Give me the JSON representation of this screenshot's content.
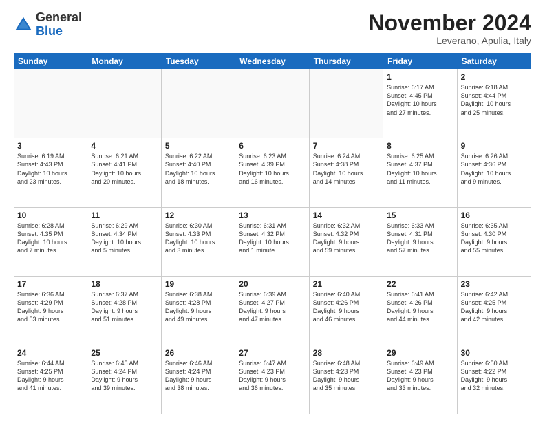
{
  "logo": {
    "line1": "General",
    "line2": "Blue",
    "icon_color": "#1a6bbf"
  },
  "title": "November 2024",
  "location": "Leverano, Apulia, Italy",
  "days_of_week": [
    "Sunday",
    "Monday",
    "Tuesday",
    "Wednesday",
    "Thursday",
    "Friday",
    "Saturday"
  ],
  "weeks": [
    [
      {
        "day": "",
        "info": "",
        "empty": true
      },
      {
        "day": "",
        "info": "",
        "empty": true
      },
      {
        "day": "",
        "info": "",
        "empty": true
      },
      {
        "day": "",
        "info": "",
        "empty": true
      },
      {
        "day": "",
        "info": "",
        "empty": true
      },
      {
        "day": "1",
        "info": "Sunrise: 6:17 AM\nSunset: 4:45 PM\nDaylight: 10 hours\nand 27 minutes."
      },
      {
        "day": "2",
        "info": "Sunrise: 6:18 AM\nSunset: 4:44 PM\nDaylight: 10 hours\nand 25 minutes."
      }
    ],
    [
      {
        "day": "3",
        "info": "Sunrise: 6:19 AM\nSunset: 4:43 PM\nDaylight: 10 hours\nand 23 minutes."
      },
      {
        "day": "4",
        "info": "Sunrise: 6:21 AM\nSunset: 4:41 PM\nDaylight: 10 hours\nand 20 minutes."
      },
      {
        "day": "5",
        "info": "Sunrise: 6:22 AM\nSunset: 4:40 PM\nDaylight: 10 hours\nand 18 minutes."
      },
      {
        "day": "6",
        "info": "Sunrise: 6:23 AM\nSunset: 4:39 PM\nDaylight: 10 hours\nand 16 minutes."
      },
      {
        "day": "7",
        "info": "Sunrise: 6:24 AM\nSunset: 4:38 PM\nDaylight: 10 hours\nand 14 minutes."
      },
      {
        "day": "8",
        "info": "Sunrise: 6:25 AM\nSunset: 4:37 PM\nDaylight: 10 hours\nand 11 minutes."
      },
      {
        "day": "9",
        "info": "Sunrise: 6:26 AM\nSunset: 4:36 PM\nDaylight: 10 hours\nand 9 minutes."
      }
    ],
    [
      {
        "day": "10",
        "info": "Sunrise: 6:28 AM\nSunset: 4:35 PM\nDaylight: 10 hours\nand 7 minutes."
      },
      {
        "day": "11",
        "info": "Sunrise: 6:29 AM\nSunset: 4:34 PM\nDaylight: 10 hours\nand 5 minutes."
      },
      {
        "day": "12",
        "info": "Sunrise: 6:30 AM\nSunset: 4:33 PM\nDaylight: 10 hours\nand 3 minutes."
      },
      {
        "day": "13",
        "info": "Sunrise: 6:31 AM\nSunset: 4:32 PM\nDaylight: 10 hours\nand 1 minute."
      },
      {
        "day": "14",
        "info": "Sunrise: 6:32 AM\nSunset: 4:32 PM\nDaylight: 9 hours\nand 59 minutes."
      },
      {
        "day": "15",
        "info": "Sunrise: 6:33 AM\nSunset: 4:31 PM\nDaylight: 9 hours\nand 57 minutes."
      },
      {
        "day": "16",
        "info": "Sunrise: 6:35 AM\nSunset: 4:30 PM\nDaylight: 9 hours\nand 55 minutes."
      }
    ],
    [
      {
        "day": "17",
        "info": "Sunrise: 6:36 AM\nSunset: 4:29 PM\nDaylight: 9 hours\nand 53 minutes."
      },
      {
        "day": "18",
        "info": "Sunrise: 6:37 AM\nSunset: 4:28 PM\nDaylight: 9 hours\nand 51 minutes."
      },
      {
        "day": "19",
        "info": "Sunrise: 6:38 AM\nSunset: 4:28 PM\nDaylight: 9 hours\nand 49 minutes."
      },
      {
        "day": "20",
        "info": "Sunrise: 6:39 AM\nSunset: 4:27 PM\nDaylight: 9 hours\nand 47 minutes."
      },
      {
        "day": "21",
        "info": "Sunrise: 6:40 AM\nSunset: 4:26 PM\nDaylight: 9 hours\nand 46 minutes."
      },
      {
        "day": "22",
        "info": "Sunrise: 6:41 AM\nSunset: 4:26 PM\nDaylight: 9 hours\nand 44 minutes."
      },
      {
        "day": "23",
        "info": "Sunrise: 6:42 AM\nSunset: 4:25 PM\nDaylight: 9 hours\nand 42 minutes."
      }
    ],
    [
      {
        "day": "24",
        "info": "Sunrise: 6:44 AM\nSunset: 4:25 PM\nDaylight: 9 hours\nand 41 minutes."
      },
      {
        "day": "25",
        "info": "Sunrise: 6:45 AM\nSunset: 4:24 PM\nDaylight: 9 hours\nand 39 minutes."
      },
      {
        "day": "26",
        "info": "Sunrise: 6:46 AM\nSunset: 4:24 PM\nDaylight: 9 hours\nand 38 minutes."
      },
      {
        "day": "27",
        "info": "Sunrise: 6:47 AM\nSunset: 4:23 PM\nDaylight: 9 hours\nand 36 minutes."
      },
      {
        "day": "28",
        "info": "Sunrise: 6:48 AM\nSunset: 4:23 PM\nDaylight: 9 hours\nand 35 minutes."
      },
      {
        "day": "29",
        "info": "Sunrise: 6:49 AM\nSunset: 4:23 PM\nDaylight: 9 hours\nand 33 minutes."
      },
      {
        "day": "30",
        "info": "Sunrise: 6:50 AM\nSunset: 4:22 PM\nDaylight: 9 hours\nand 32 minutes."
      }
    ]
  ]
}
